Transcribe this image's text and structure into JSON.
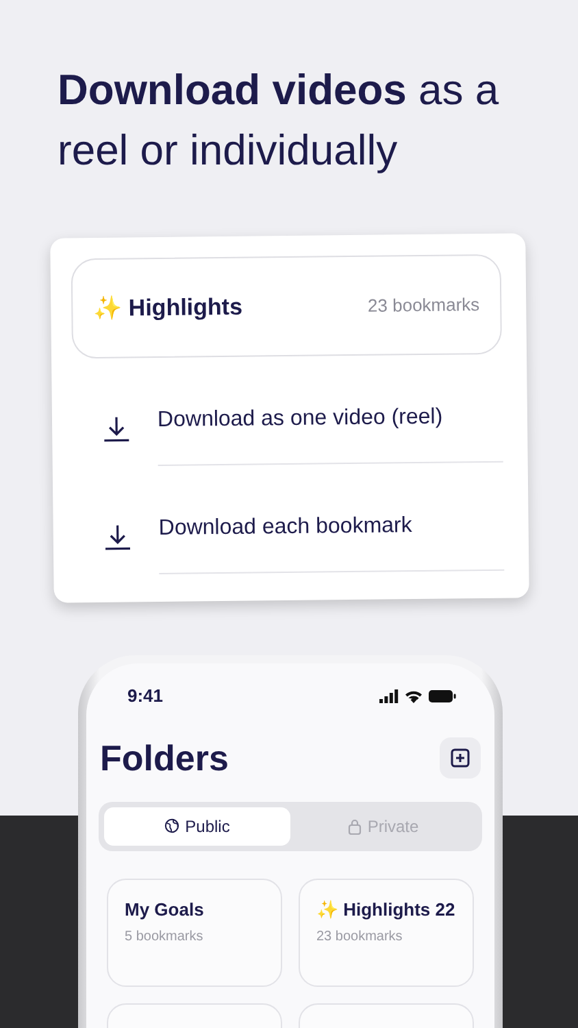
{
  "headline": "**Download videos** as a reel or individually",
  "folder_card": {
    "title": "✨ Highlights",
    "count": "23 bookmarks"
  },
  "download_options": [
    {
      "label": "Download as one video (reel)"
    },
    {
      "label": "Download each bookmark"
    }
  ],
  "phone": {
    "time": "9:41",
    "title": "Folders",
    "tabs": [
      {
        "label": "Public",
        "selected": true
      },
      {
        "label": "Private",
        "selected": false
      }
    ],
    "folders": [
      {
        "kind": "full",
        "title": "My Goals",
        "count": "5 bookmarks"
      },
      {
        "kind": "full",
        "title": "✨ Highlights 22",
        "count": "23 bookmarks"
      },
      {
        "kind": "partial"
      },
      {
        "kind": "partial"
      }
    ]
  }
}
